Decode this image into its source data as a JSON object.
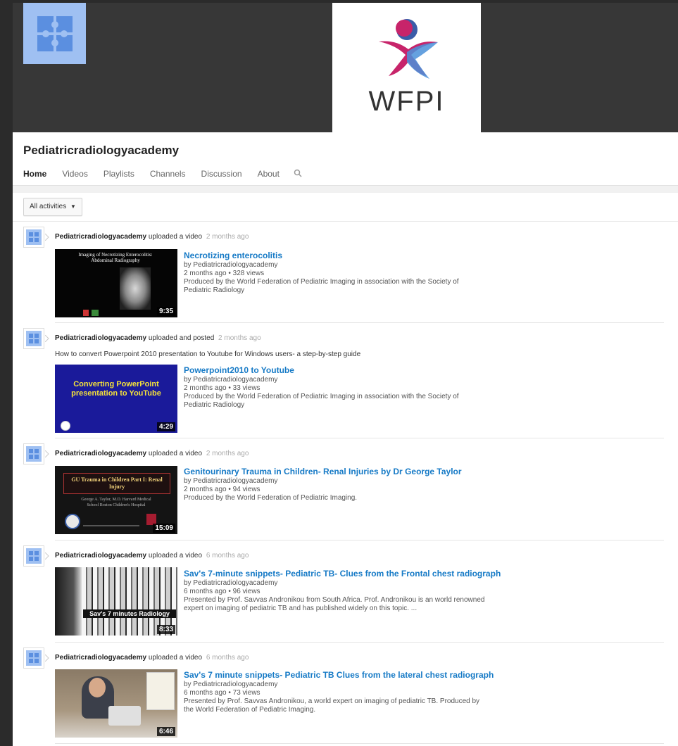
{
  "banner": {
    "logo_text": "WFPI",
    "avatar_color": "#9fc0f2"
  },
  "channel": {
    "title": "Pediatricradiologyacademy"
  },
  "tabs": [
    {
      "label": "Home",
      "active": true
    },
    {
      "label": "Videos"
    },
    {
      "label": "Playlists"
    },
    {
      "label": "Channels"
    },
    {
      "label": "Discussion"
    },
    {
      "label": "About"
    }
  ],
  "filter": {
    "label": "All activities"
  },
  "feed": [
    {
      "author": "Pediatricradiologyacademy",
      "action": "uploaded a video",
      "when": "2 months ago",
      "description": "",
      "video": {
        "title": "Necrotizing enterocolitis",
        "by": "by Pediatricradiologyacademy",
        "stats": "2 months ago • 328 views",
        "summary": "Produced by the World Federation of Pediatric Imaging in association with the Society of Pediatric Radiology",
        "duration": "9:35",
        "thumb_title": "Imaging of Necrotizing Enterocolitis: Abdominal Radiography"
      }
    },
    {
      "author": "Pediatricradiologyacademy",
      "action": "uploaded and posted",
      "when": "2 months ago",
      "description": "How to convert Powerpoint 2010 presentation to Youtube for Windows users- a step-by-step guide",
      "video": {
        "title": "Powerpoint2010 to Youtube",
        "by": "by Pediatricradiologyacademy",
        "stats": "2 months ago • 33 views",
        "summary": "Produced by the World Federation of Pediatric Imaging in association with the Society of Pediatric Radiology",
        "duration": "4:29",
        "thumb_title": "Converting PowerPoint presentation to YouTube"
      }
    },
    {
      "author": "Pediatricradiologyacademy",
      "action": "uploaded a video",
      "when": "2 months ago",
      "description": "",
      "video": {
        "title": "Genitourinary Trauma in Children- Renal Injuries by Dr George Taylor",
        "by": "by Pediatricradiologyacademy",
        "stats": "2 months ago • 94 views",
        "summary": "Produced by the World Federation of Pediatric Imaging.",
        "duration": "15:09",
        "thumb_title": "GU Trauma in Children Part I: Renal Injury",
        "thumb_sub": "George A. Taylor, M.D. Harvard Medical School Boston Children's Hospital"
      }
    },
    {
      "author": "Pediatricradiologyacademy",
      "action": "uploaded a video",
      "when": "6 months ago",
      "description": "",
      "video": {
        "title": "Sav's 7-minute snippets- Pediatric TB- Clues from the Frontal chest radiograph",
        "by": "by Pediatricradiologyacademy",
        "stats": "6 months ago • 96 views",
        "summary": "Presented by Prof. Savvas Andronikou from South Africa. Prof. Andronikou is an world renowned expert on imaging of pediatric TB and has published widely on this topic. ...",
        "duration": "8:33",
        "thumb_title": "Sav's 7 minutes Radiology"
      }
    },
    {
      "author": "Pediatricradiologyacademy",
      "action": "uploaded a video",
      "when": "6 months ago",
      "description": "",
      "video": {
        "title": "Sav's 7 minute snippets- Pediatric TB Clues from the lateral chest radiograph",
        "by": "by Pediatricradiologyacademy",
        "stats": "6 months ago • 73 views",
        "summary": "Presented by Prof. Savvas Andronikou, a world expert on imaging of pediatric TB. Produced by the World Federation of Pediatric Imaging.",
        "duration": "6:46"
      }
    }
  ]
}
